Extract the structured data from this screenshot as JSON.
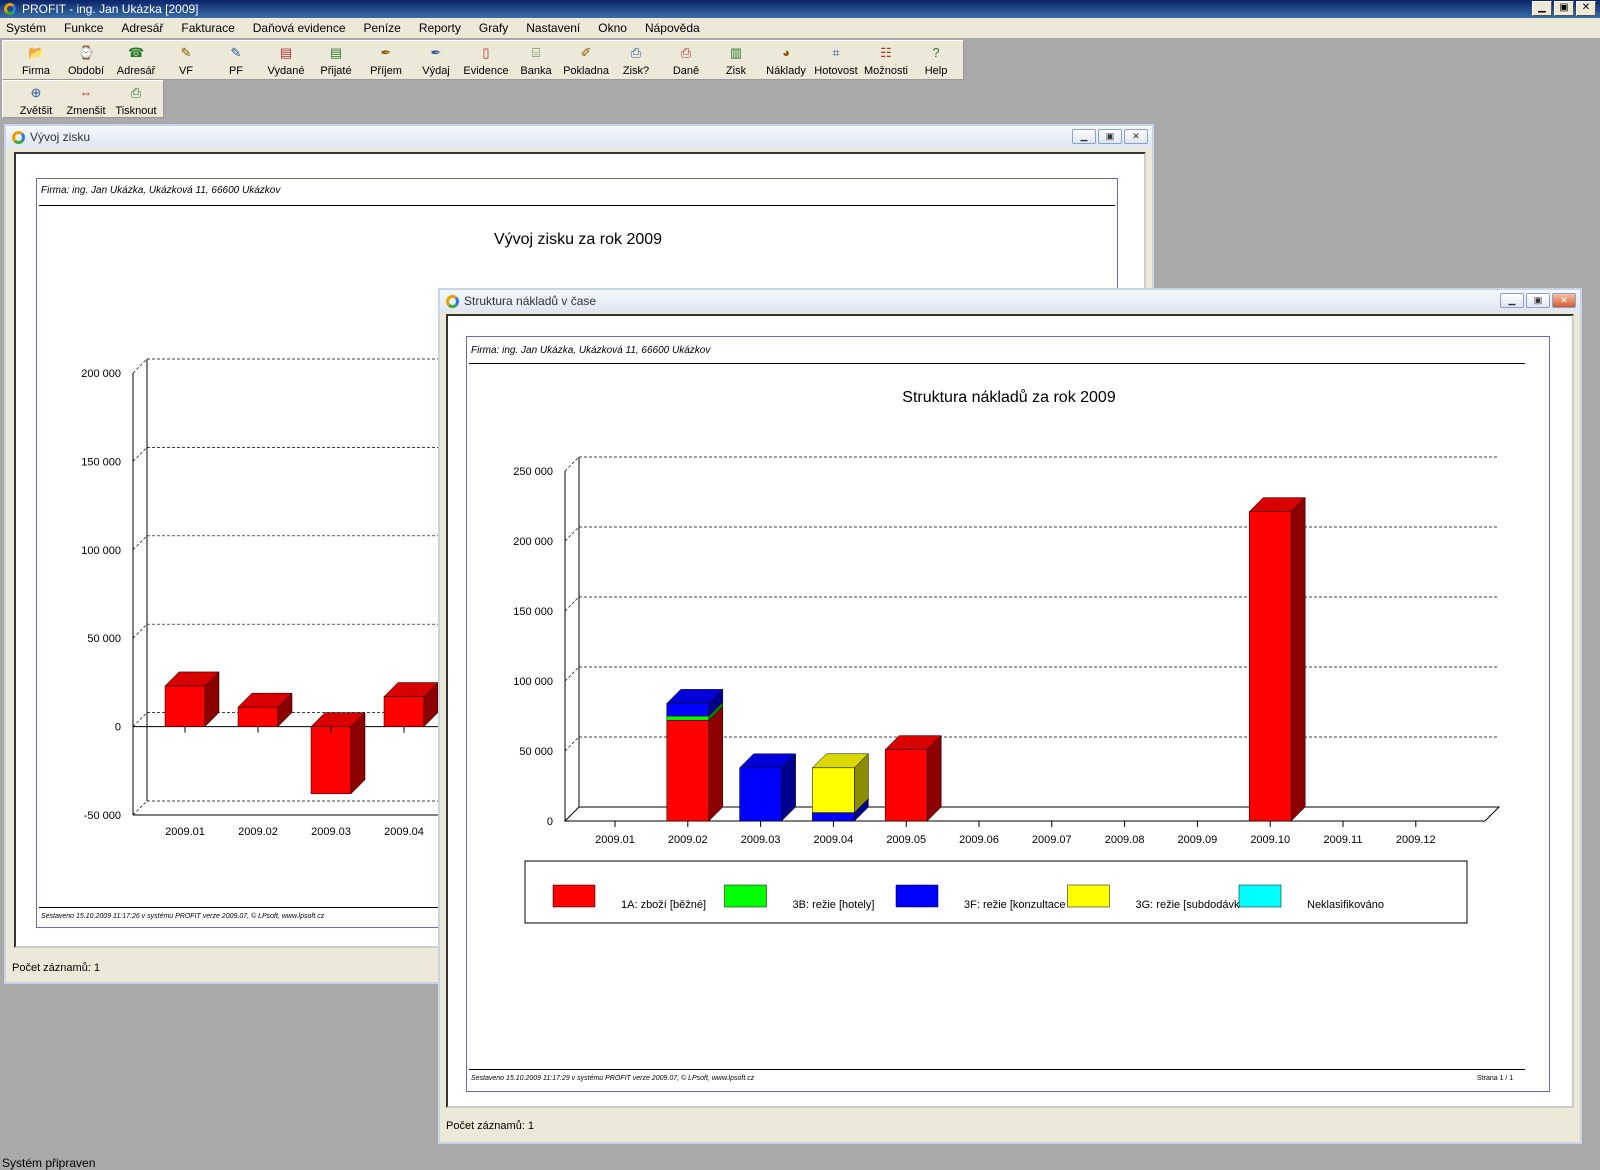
{
  "window": {
    "title": "PROFIT - ing. Jan Ukázka [2009]",
    "btn_min": "▁",
    "btn_max": "▣",
    "btn_close": "✕"
  },
  "menu": [
    "Systém",
    "Funkce",
    "Adresář",
    "Fakturace",
    "Daňová evidence",
    "Peníze",
    "Reporty",
    "Grafy",
    "Nastavení",
    "Okno",
    "Nápověda"
  ],
  "toolbar_main": [
    {
      "label": "Firma",
      "icon": "folder-icon",
      "glyph": "📂"
    },
    {
      "label": "Období",
      "icon": "calendar-icon",
      "glyph": "⌚"
    },
    {
      "label": "Adresář",
      "icon": "phone-icon",
      "glyph": "☎"
    },
    {
      "label": "VF",
      "icon": "issued-invoice-icon",
      "glyph": "✎"
    },
    {
      "label": "PF",
      "icon": "received-invoice-icon",
      "glyph": "✎"
    },
    {
      "label": "Vydané",
      "icon": "issued-docs-icon",
      "glyph": "▤"
    },
    {
      "label": "Přijaté",
      "icon": "received-docs-icon",
      "glyph": "▤"
    },
    {
      "label": "Příjem",
      "icon": "income-pen-icon",
      "glyph": "✒"
    },
    {
      "label": "Výdaj",
      "icon": "expense-pen-icon",
      "glyph": "✒"
    },
    {
      "label": "Evidence",
      "icon": "ledger-icon",
      "glyph": "▯"
    },
    {
      "label": "Banka",
      "icon": "bank-icon",
      "glyph": "⌸"
    },
    {
      "label": "Pokladna",
      "icon": "cashbox-icon",
      "glyph": "✐"
    },
    {
      "label": "Zisk?",
      "icon": "profit-query-icon",
      "glyph": "⎙"
    },
    {
      "label": "Daně",
      "icon": "tax-icon",
      "glyph": "⎙"
    },
    {
      "label": "Zisk",
      "icon": "bar-chart-icon",
      "glyph": "▥"
    },
    {
      "label": "Náklady",
      "icon": "pie-chart-icon",
      "glyph": "◕"
    },
    {
      "label": "Hotovost",
      "icon": "line-chart-icon",
      "glyph": "⌗"
    },
    {
      "label": "Možnosti",
      "icon": "options-icon",
      "glyph": "☷"
    },
    {
      "label": "Help",
      "icon": "help-icon",
      "glyph": "?"
    }
  ],
  "toolbar_zoom": [
    {
      "label": "Zvětšit",
      "icon": "zoom-in-icon",
      "glyph": "⊕"
    },
    {
      "label": "Zmenšit",
      "icon": "zoom-out-icon",
      "glyph": "⇔"
    },
    {
      "label": "Tisknout",
      "icon": "print-icon",
      "glyph": "⎙"
    }
  ],
  "profit_window": {
    "title": "Vývoj zisku",
    "firm": "Firma: ing. Jan Ukázka, Ukázková 11, 66600 Ukázkov",
    "report_title": "Vývoj zisku za rok 2009",
    "footer": "Sestaveno 15.10.2009 11:17:26 v systému PROFIT verze 2009.07, © LPsoft, www.lpsoft.cz",
    "status": "Počet záznamů: 1"
  },
  "cost_window": {
    "title": "Struktura nákladů v čase",
    "firm": "Firma: ing. Jan Ukázka, Ukázková 11, 66600 Ukázkov",
    "report_title": "Struktura nákladů za rok 2009",
    "footer": "Sestaveno 15.10.2009 11:17:29 v systému PROFIT verze 2009.07, © LPsoft, www.lpsoft.cz",
    "page": "Strana 1 / 1",
    "status": "Počet záznamů: 1"
  },
  "status_bar": "Systém připraven",
  "colors": {
    "red": "#ff0000",
    "green": "#00ff00",
    "blue": "#0000ff",
    "yellow": "#ffff00",
    "cyan": "#00ffff"
  },
  "chart_data": [
    {
      "type": "bar",
      "categories": [
        "2009.01",
        "2009.02",
        "2009.03",
        "2009.04"
      ],
      "values": [
        23000,
        11000,
        -38000,
        17000
      ],
      "ylim": [
        -50000,
        200000
      ],
      "yticks": [
        "200 000",
        "150 000",
        "100 000",
        "50 000",
        "0",
        "-50 000"
      ],
      "ytick_values": [
        200000,
        150000,
        100000,
        50000,
        0,
        -50000
      ],
      "grid": true
    },
    {
      "type": "bar",
      "stacked": true,
      "categories": [
        "2009.01",
        "2009.02",
        "2009.03",
        "2009.04",
        "2009.05",
        "2009.06",
        "2009.07",
        "2009.08",
        "2009.09",
        "2009.10",
        "2009.11",
        "2009.12"
      ],
      "series": [
        {
          "name": "1A: zboží [běžné]",
          "color": "#ff0000",
          "values": [
            0,
            72000,
            0,
            0,
            51000,
            0,
            0,
            0,
            0,
            221000,
            0,
            0
          ]
        },
        {
          "name": "3B: režie [hotely]",
          "color": "#00ff00",
          "values": [
            0,
            3000,
            0,
            0,
            0,
            0,
            0,
            0,
            0,
            0,
            0,
            0
          ]
        },
        {
          "name": "3F: režie [konzultace",
          "color": "#0000ff",
          "values": [
            0,
            9000,
            38000,
            6000,
            0,
            0,
            0,
            0,
            0,
            0,
            0,
            0
          ]
        },
        {
          "name": "3G: režie [subdodávk",
          "color": "#ffff00",
          "values": [
            0,
            0,
            0,
            32000,
            0,
            0,
            0,
            0,
            0,
            0,
            0,
            0
          ]
        },
        {
          "name": "Neklasifikováno",
          "color": "#00ffff",
          "values": [
            0,
            0,
            0,
            0,
            0,
            0,
            0,
            0,
            0,
            0,
            0,
            0
          ]
        }
      ],
      "ylim": [
        0,
        250000
      ],
      "yticks": [
        "250 000",
        "200 000",
        "150 000",
        "100 000",
        "50 000",
        "0"
      ],
      "ytick_values": [
        250000,
        200000,
        150000,
        100000,
        50000,
        0
      ],
      "grid": true,
      "legend": "bottom"
    }
  ]
}
